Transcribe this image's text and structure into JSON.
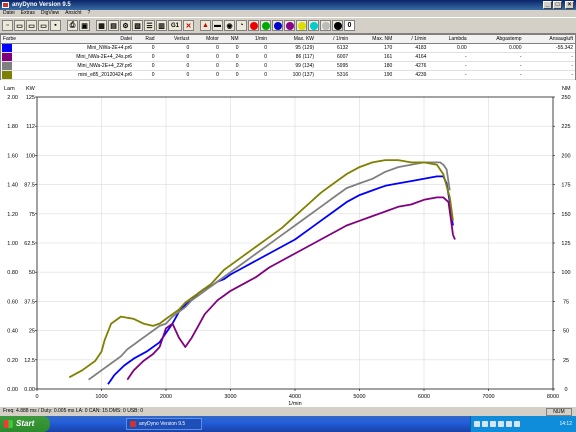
{
  "window": {
    "title": "anyDyno Version 9.5"
  },
  "menu": [
    "Datei",
    "Extras",
    "DigView",
    "Ansicht",
    "?"
  ],
  "toolbar": {
    "g1_label": "G1",
    "counter_value": "0"
  },
  "legend_table": {
    "headers": [
      "Farbe",
      "Datei",
      "Rad",
      "Verlust",
      "Motor",
      "NM",
      "1/min",
      "Max. KW",
      "/ 1/min",
      "Max. NM",
      "/ 1/min",
      "Lambda",
      "Abgastemp",
      "Ansaugluft"
    ],
    "rows": [
      {
        "color": "#0000ff",
        "file": "Mini_NWa-2E+4.pr6",
        "rad": "0",
        "verlust": "0",
        "motor": "0",
        "nm": "0",
        "rpm": "0",
        "max_kw": "95 (129)",
        "rpm_kw": "6132",
        "max_nm": "170",
        "rpm_nm": "4183",
        "lambda": "0.00",
        "abgastemp": "0.000",
        "ansaugluft": "-55.342"
      },
      {
        "color": "#800080",
        "file": "Mini_NWa-2E+4_24s.pr6",
        "rad": "0",
        "verlust": "0",
        "motor": "0",
        "nm": "0",
        "rpm": "0",
        "max_kw": "86 (117)",
        "rpm_kw": "6007",
        "max_nm": "161",
        "rpm_nm": "4164",
        "lambda": "-",
        "abgastemp": "-",
        "ansaugluft": "-"
      },
      {
        "color": "#808080",
        "file": "Mini_NWa-2E+4_22f.pr6",
        "rad": "0",
        "verlust": "0",
        "motor": "0",
        "nm": "0",
        "rpm": "0",
        "max_kw": "99 (134)",
        "rpm_kw": "5995",
        "max_nm": "180",
        "rpm_nm": "4276",
        "lambda": "-",
        "abgastemp": "-",
        "ansaugluft": "-"
      },
      {
        "color": "#808000",
        "file": "mini_e85_20120424.pr6",
        "rad": "0",
        "verlust": "0",
        "motor": "0",
        "nm": "0",
        "rpm": "0",
        "max_kw": "100 (137)",
        "rpm_kw": "5316",
        "max_nm": "190",
        "rpm_nm": "4239",
        "lambda": "-",
        "abgastemp": "-",
        "ansaugluft": "-"
      }
    ]
  },
  "chart_data": {
    "type": "line",
    "xlabel": "1/min",
    "axis_labels": {
      "lam": "Lam",
      "kw": "KW",
      "nm": "NM"
    },
    "xlim": [
      0,
      8000
    ],
    "x_ticks": [
      "0",
      "1000",
      "2000",
      "3000",
      "4000",
      "5000",
      "6000",
      "7000",
      "8000"
    ],
    "lam_ticks": [
      "0.00",
      "0.20",
      "0.40",
      "0.60",
      "0.80",
      "1.00",
      "1.20",
      "1.40",
      "1.60",
      "1.80",
      "2.00"
    ],
    "kw_ticks": [
      "0.00",
      "12.5",
      "25",
      "37.5",
      "50",
      "62.5",
      "75",
      "87.5",
      "100",
      "112",
      "125"
    ],
    "nm_ticks": [
      "0",
      "25",
      "50",
      "75",
      "100",
      "125",
      "150",
      "175",
      "200",
      "225",
      "250"
    ],
    "kw_range": [
      0,
      125
    ],
    "grid": true,
    "series": [
      {
        "name": "Mini_NWa-2E+4.pr6",
        "color": "#0000ff",
        "x": [
          1100,
          1200,
          1350,
          1500,
          1700,
          1900,
          2000,
          2100,
          2200,
          2300,
          2400,
          2500,
          2600,
          2700,
          2800,
          2900,
          3000,
          3200,
          3400,
          3600,
          3800,
          4000,
          4200,
          4400,
          4600,
          4800,
          5000,
          5200,
          5400,
          5600,
          5800,
          6000,
          6200,
          6300,
          6350,
          6400,
          6420,
          6450
        ],
        "y": [
          2,
          6,
          10,
          13,
          16,
          20,
          24,
          28,
          33,
          36,
          38,
          41,
          43,
          44,
          46,
          47,
          49,
          52,
          55,
          58,
          61,
          64,
          68,
          72,
          76,
          80,
          83,
          85,
          87,
          88,
          89,
          90,
          91,
          91,
          88,
          80,
          75,
          70
        ]
      },
      {
        "name": "Mini_NWa-2E+4_24s.pr6",
        "color": "#800080",
        "x": [
          1400,
          1500,
          1650,
          1800,
          1900,
          2000,
          2100,
          2200,
          2300,
          2400,
          2500,
          2600,
          2700,
          2800,
          2900,
          3000,
          3200,
          3400,
          3600,
          3800,
          4000,
          4200,
          4400,
          4600,
          4800,
          5000,
          5200,
          5400,
          5600,
          5800,
          6000,
          6200,
          6300,
          6380,
          6420,
          6450,
          6480
        ],
        "y": [
          4,
          8,
          12,
          15,
          18,
          26,
          28,
          22,
          18,
          22,
          27,
          32,
          35,
          38,
          40,
          42,
          45,
          48,
          52,
          55,
          58,
          61,
          64,
          67,
          70,
          72,
          74,
          76,
          78,
          79,
          81,
          82,
          82,
          80,
          72,
          66,
          64
        ]
      },
      {
        "name": "Mini_NWa-2E+4_22f.pr6",
        "color": "#808080",
        "x": [
          800,
          900,
          1000,
          1100,
          1200,
          1300,
          1400,
          1500,
          1600,
          1700,
          1800,
          1900,
          2000,
          2100,
          2200,
          2300,
          2400,
          2500,
          2600,
          2700,
          2800,
          2900,
          3000,
          3200,
          3400,
          3600,
          3800,
          4000,
          4200,
          4400,
          4600,
          4800,
          5000,
          5200,
          5400,
          5600,
          5800,
          6000,
          6150,
          6250,
          6300,
          6350,
          6400
        ],
        "y": [
          4,
          6,
          8,
          10,
          12,
          14,
          17,
          19,
          21,
          23,
          25,
          27,
          28,
          31,
          33,
          35,
          38,
          40,
          42,
          44,
          46,
          48,
          50,
          54,
          58,
          62,
          66,
          70,
          74,
          78,
          82,
          86,
          88,
          90,
          93,
          95,
          96,
          97,
          97,
          97,
          96,
          94,
          85
        ]
      },
      {
        "name": "mini_e85_20120424.pr6",
        "color": "#808000",
        "x": [
          500,
          700,
          900,
          1000,
          1050,
          1150,
          1300,
          1500,
          1650,
          1800,
          1900,
          2000,
          2100,
          2200,
          2300,
          2400,
          2500,
          2600,
          2700,
          2800,
          2900,
          3000,
          3200,
          3400,
          3600,
          3800,
          4000,
          4200,
          4400,
          4600,
          4800,
          5000,
          5200,
          5400,
          5600,
          5800,
          6000,
          6200,
          6300,
          6400,
          6450
        ],
        "y": [
          5,
          8,
          12,
          16,
          21,
          28,
          31,
          30,
          28,
          27,
          28,
          30,
          32,
          34,
          37,
          39,
          41,
          43,
          45,
          48,
          51,
          53,
          57,
          61,
          65,
          69,
          74,
          79,
          84,
          88,
          92,
          95,
          97,
          98,
          98,
          97,
          97,
          96,
          92,
          82,
          72
        ]
      }
    ]
  },
  "status": {
    "text": "Freq: 4.888 ms / Duty: 0.005 ms LA: 0  CAN: 15 DMS: 0 USB: 0",
    "nm_indicator": "NUM"
  },
  "taskbar": {
    "start_label": "Start",
    "task_label": "anyDyno Version 9.5",
    "clock": "14:12"
  }
}
